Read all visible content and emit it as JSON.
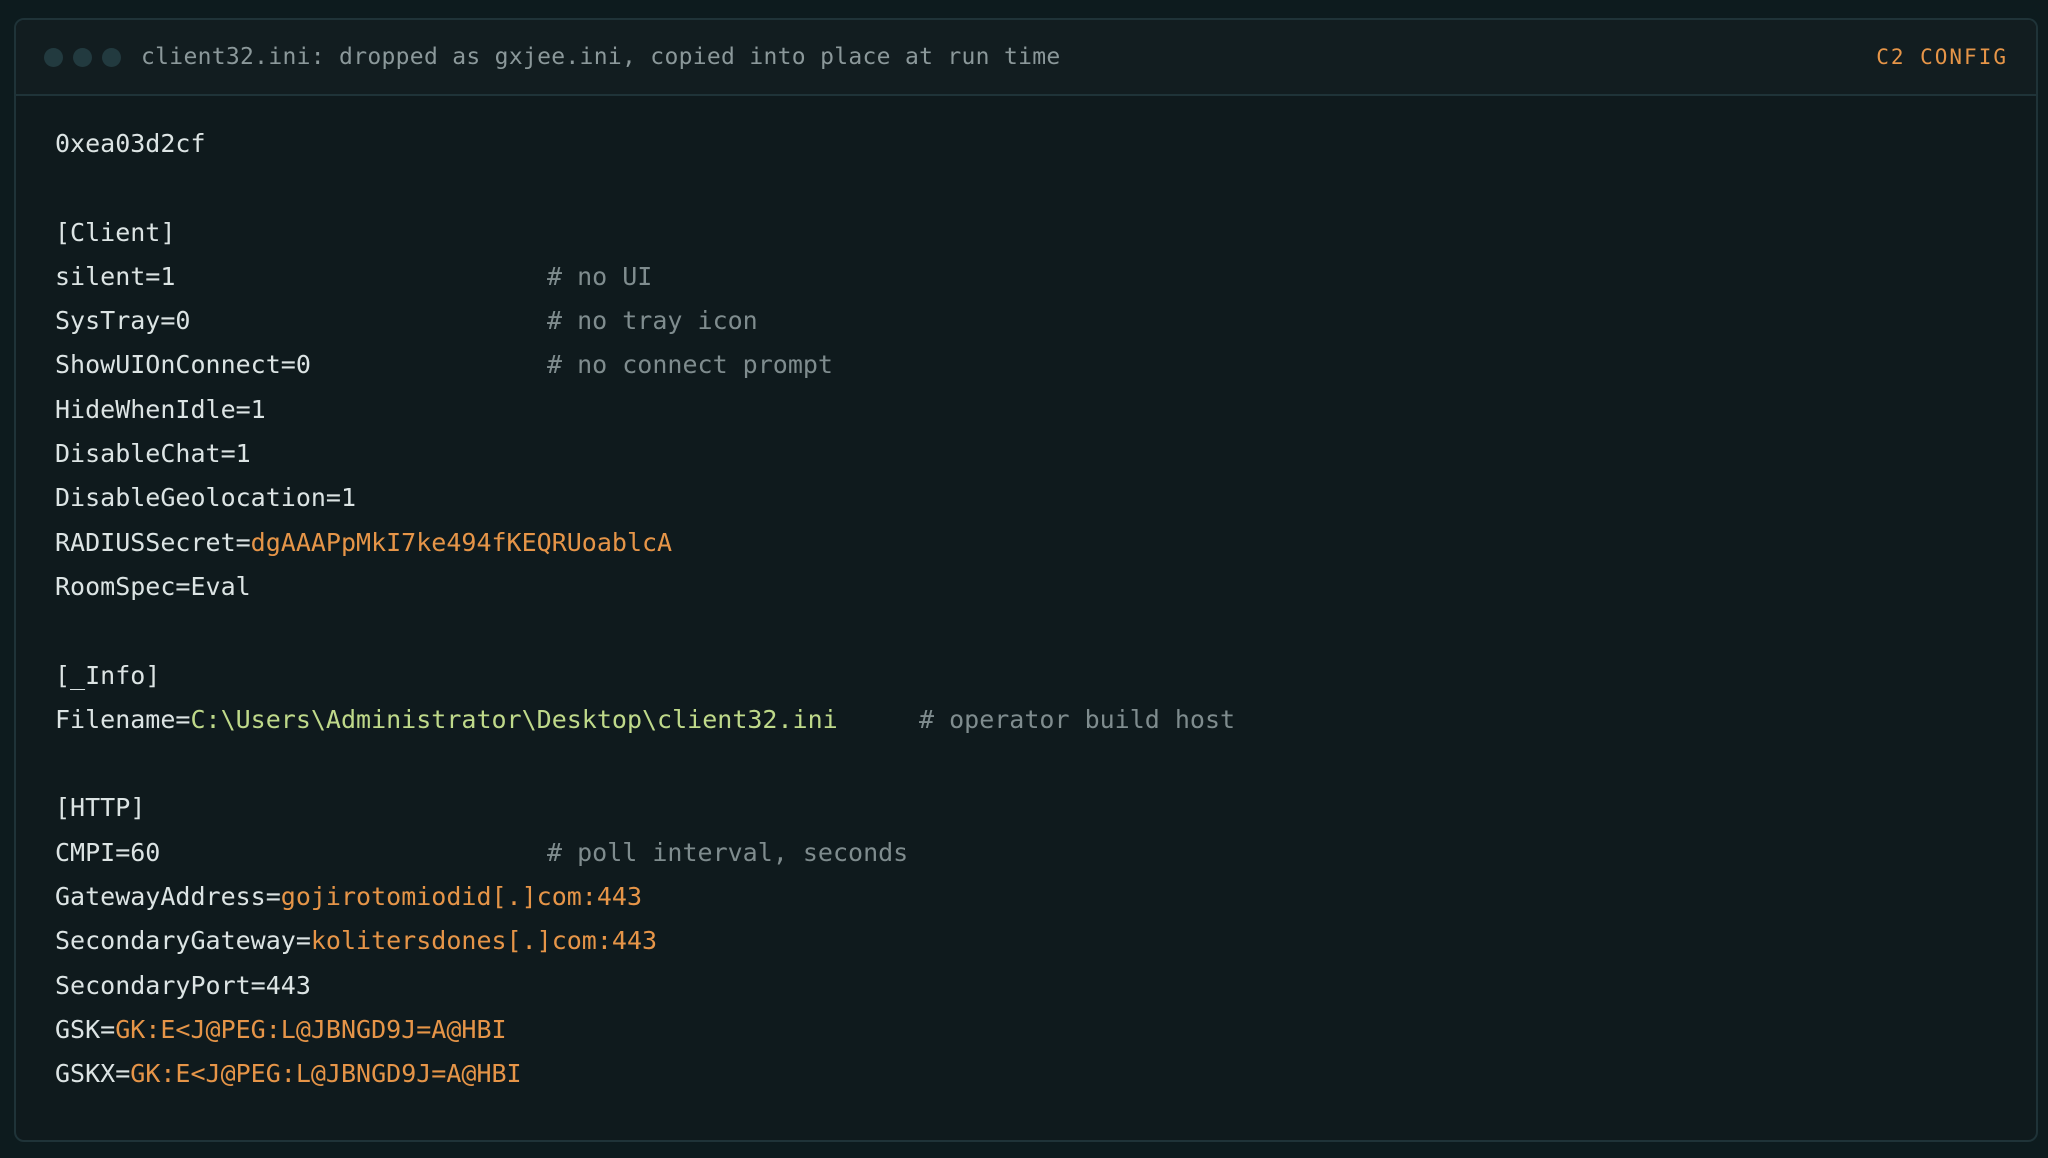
{
  "window": {
    "title": "client32.ini: dropped as gxjee.ini, copied into place at run time",
    "tag": "C2 CONFIG"
  },
  "lines": {
    "l0": {
      "key": "0xea03d2cf"
    },
    "l1": {
      "key": "[Client]"
    },
    "l2": {
      "key": "silent=1",
      "comment": "# no UI"
    },
    "l3": {
      "key": "SysTray=0",
      "comment": "# no tray icon"
    },
    "l4": {
      "key": "ShowUIOnConnect=0",
      "comment": "# no connect prompt"
    },
    "l5": {
      "key": "HideWhenIdle=1"
    },
    "l6": {
      "key": "DisableChat=1"
    },
    "l7": {
      "key": "DisableGeolocation=1"
    },
    "l8": {
      "key": "RADIUSSecret=",
      "value": "dgAAAPpMkI7ke494fKEQRUoablcA"
    },
    "l9": {
      "key": "RoomSpec=Eval"
    },
    "l10": {
      "key": "[_Info]"
    },
    "l11": {
      "key": "Filename=",
      "value": "C:\\Users\\Administrator\\Desktop\\client32.ini",
      "comment": "# operator build host"
    },
    "l12": {
      "key": "[HTTP]"
    },
    "l13": {
      "key": "CMPI=60",
      "comment": "# poll interval, seconds"
    },
    "l14": {
      "key": "GatewayAddress=",
      "value": "gojirotomiodid[.]com:443"
    },
    "l15": {
      "key": "SecondaryGateway=",
      "value": "kolitersdones[.]com:443"
    },
    "l16": {
      "key": "SecondaryPort=443"
    },
    "l17": {
      "key": "GSK=",
      "value": "GK:E<J@PEG:L@JBNGD9J=A@HBI"
    },
    "l18": {
      "key": "GSKX=",
      "value": "GK:E<J@PEG:L@JBNGD9J=A@HBI"
    }
  },
  "colors": {
    "background": "#0d1b1e",
    "text": "#dce4e4",
    "comment": "#7f8c8e",
    "value_orange": "#e69548",
    "value_green": "#bfd98a"
  }
}
